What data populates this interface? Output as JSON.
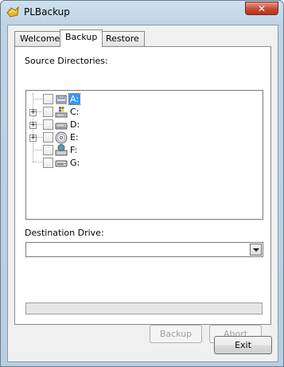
{
  "window": {
    "title": "PLBackup",
    "close_label": "✕",
    "app_icon": "plbackup-app-icon"
  },
  "tabs": [
    {
      "label": "Welcome",
      "active": false
    },
    {
      "label": "Backup",
      "active": true
    },
    {
      "label": "Restore",
      "active": false
    }
  ],
  "backup": {
    "source_label": "Source Directories:",
    "drives": [
      {
        "label": "A:",
        "icon": "floppy-drive-icon",
        "expandable": false,
        "checked": false,
        "selected": true
      },
      {
        "label": "C:",
        "icon": "windows-drive-icon",
        "expandable": true,
        "checked": false,
        "selected": false
      },
      {
        "label": "D:",
        "icon": "hard-drive-icon",
        "expandable": true,
        "checked": false,
        "selected": false
      },
      {
        "label": "E:",
        "icon": "cd-drive-icon",
        "expandable": true,
        "checked": false,
        "selected": false
      },
      {
        "label": "F:",
        "icon": "network-drive-icon",
        "expandable": false,
        "checked": false,
        "selected": false
      },
      {
        "label": "G:",
        "icon": "removable-drive-icon",
        "expandable": false,
        "checked": false,
        "selected": false
      }
    ],
    "destination_label": "Destination Drive:",
    "destination_value": "",
    "progress": 0,
    "backup_button": "Backup",
    "abort_button": "Abort"
  },
  "exit_button": "Exit"
}
